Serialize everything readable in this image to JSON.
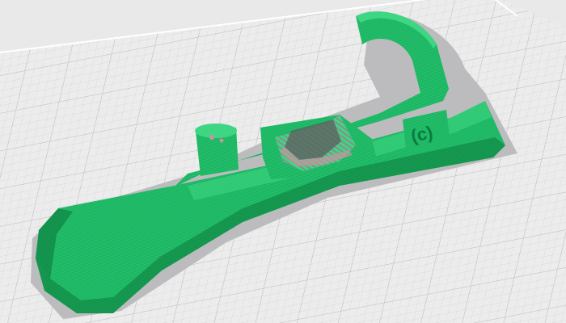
{
  "viewport": {
    "build_plate_color": "#ececec",
    "grid_color_minor": "#d2d2d3",
    "grid_color_major": "#bdbdbf",
    "background_color": "#e9e9ea",
    "shadow_color": "#bcbcbe",
    "model_color": "#17b15e",
    "model_dark_color": "#0c7a3d",
    "model_light_color": "#3ed682",
    "infill_gray_color": "#8c8c8e",
    "infill_dark_color": "#5c5c5e",
    "infill_pink_color": "#c894a0"
  },
  "model": {
    "label_glyph": "(c)"
  }
}
